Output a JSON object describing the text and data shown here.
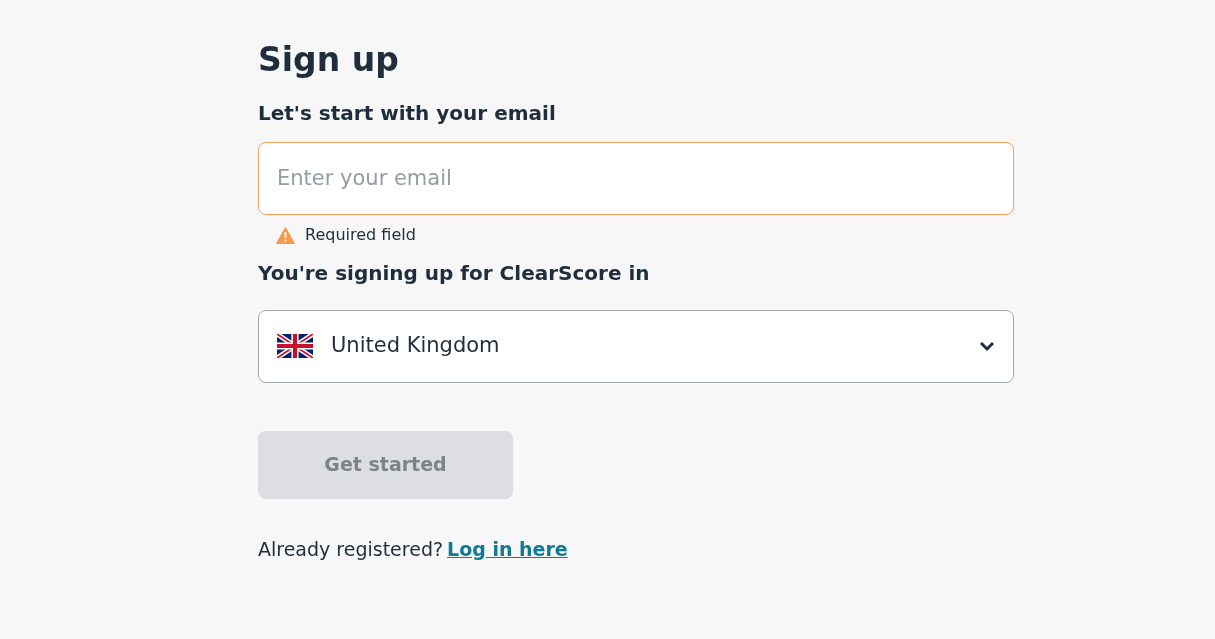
{
  "title": "Sign up",
  "email_label": "Let's start with your email",
  "email": {
    "placeholder": "Enter your email",
    "invalid": true,
    "error": "Required field"
  },
  "country_label": "You're signing up for ClearScore in",
  "country": {
    "value": "United Kingdom"
  },
  "submit": {
    "label": "Get started",
    "disabled": true
  },
  "login": {
    "prompt": "Already registered?",
    "link": "Log in here"
  }
}
